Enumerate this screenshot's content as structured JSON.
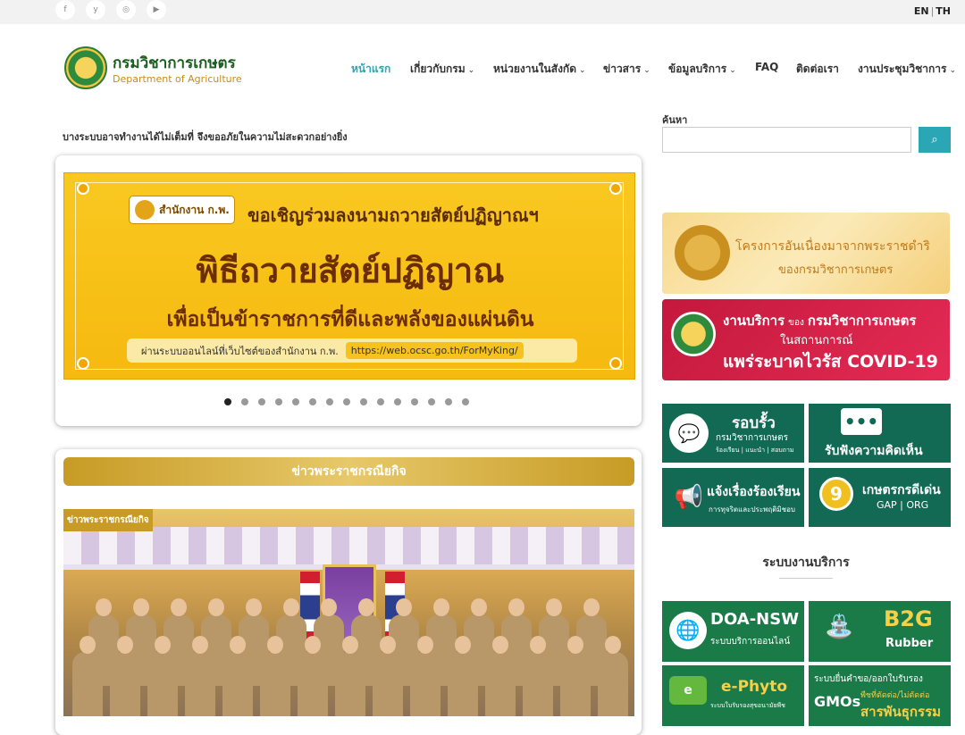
{
  "topbar": {
    "social": [
      {
        "name": "facebook",
        "glyph": "f"
      },
      {
        "name": "twitter",
        "glyph": "y"
      },
      {
        "name": "instagram",
        "glyph": "◎"
      },
      {
        "name": "youtube",
        "glyph": "▶"
      }
    ],
    "lang_en": "EN",
    "lang_sep": "|",
    "lang_th": "TH"
  },
  "header": {
    "logo_th": "กรมวิชาการเกษตร",
    "logo_en": "Department of Agriculture",
    "nav": [
      {
        "label": "หน้าแรก",
        "active": true,
        "dropdown": false
      },
      {
        "label": "เกี่ยวกับกรม",
        "active": false,
        "dropdown": true
      },
      {
        "label": "หน่วยงานในสังกัด",
        "active": false,
        "dropdown": true
      },
      {
        "label": "ข่าวสาร",
        "active": false,
        "dropdown": true
      },
      {
        "label": "ข้อมูลบริการ",
        "active": false,
        "dropdown": true
      },
      {
        "label": "FAQ",
        "active": false,
        "dropdown": false
      },
      {
        "label": "ติดต่อเรา",
        "active": false,
        "dropdown": false
      },
      {
        "label": "งานประชุมวิชาการ",
        "active": false,
        "dropdown": true
      }
    ],
    "chevron": "⌄"
  },
  "notice": "บางระบบอาจทำงานได้ไม่เต็มที่ จึงขออภัยในความไม่สะดวกอย่างยิ่ง",
  "search": {
    "label": "ค้นหา",
    "placeholder": "",
    "button_glyph": "⌕"
  },
  "slider": {
    "ocsc_logo": "สำนักงาน ก.พ.",
    "line1": "ขอเชิญร่วมลงนามถวายสัตย์ปฏิญาณฯ",
    "line2": "พิธีถวายสัตย์ปฏิญาณ",
    "line3": "เพื่อเป็นข้าราชการที่ดีและพลังของแผ่นดิน",
    "url_prefix": "ผ่านระบบออนไลน์ที่เว็บไซต์ของสำนักงาน ก.พ.",
    "url": "https://web.ocsc.go.th/ForMyKing/",
    "dots_total": 15,
    "dots_active": 0
  },
  "news": {
    "section_title": "ข่าวพระราชกรณียกิจ",
    "photo_tag": "ข่าวพระราชกรณียกิจ"
  },
  "right": {
    "royal_line1": "โครงการอันเนื่องมาจากพระราชดำริ",
    "royal_line2": "ของกรมวิชาการเกษตร",
    "covid_line1a": "งานบริการ",
    "covid_line1b": "ของ",
    "covid_line1c": "กรมวิชาการเกษตร",
    "covid_line2": "ในสถานการณ์",
    "covid_line3": "แพร่ระบาดไวรัส COVID-19",
    "tiles": [
      {
        "title": "รอบรั้ว",
        "sub1": "กรมวิชาการเกษตร",
        "sub2": "ร้องเรียน | แนะนำ | สอบถาม",
        "icon": "💬"
      },
      {
        "title": "รับฟังความคิดเห็น",
        "sub1": "",
        "sub2": "",
        "icon": "•••"
      },
      {
        "title": "แจ้งเรื่องร้องเรียน",
        "sub1": "การทุจริตและประพฤติมิชอบ",
        "sub2": "",
        "icon": "📢"
      },
      {
        "title": "เกษตรกรดีเด่น",
        "sub1": "GAP | ORG",
        "sub2": "",
        "icon": "9"
      }
    ],
    "services_title": "ระบบงานบริการ",
    "services": [
      {
        "title": "DOA-NSW",
        "sub": "ระบบบริการออนไลน์",
        "icon": "🌐"
      },
      {
        "title": "B2G",
        "sub": "Rubber",
        "icon": "⛲"
      },
      {
        "title": "e-Phyto",
        "sub": "ระบบใบรับรองสุขอนามัยพืช",
        "icon": "e"
      },
      {
        "title": "GMOs",
        "sub": "ระบบยื่นคำขอ/ออกใบรับรอง",
        "sub2": "พืชที่ตัดต่อ/ไม่ตัดต่อ",
        "sub3": "สารพันธุกรรม",
        "icon": ""
      }
    ]
  }
}
